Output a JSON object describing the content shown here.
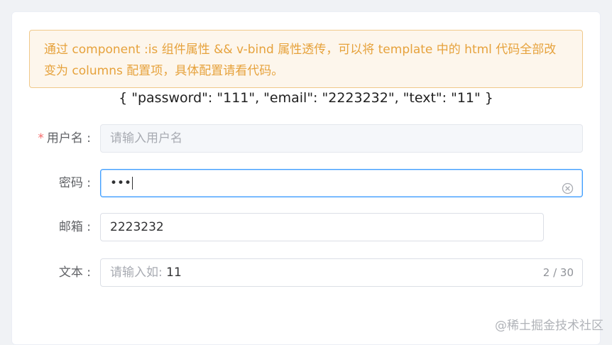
{
  "alert": {
    "text": "通过 component :is 组件属性 && v-bind 属性透传，可以将 template 中的 html 代码全部改变为 columns 配置项，具体配置请看代码。"
  },
  "model_json": "{ \"password\": \"111\", \"email\": \"2223232\", \"text\": \"11\" }",
  "form": {
    "username": {
      "required_mark": "*",
      "label": "用户名 :",
      "placeholder": "请输入用户名",
      "value": ""
    },
    "password": {
      "label": "密码 :",
      "masked_value": "•••",
      "clear_icon": "circle-close-icon"
    },
    "email": {
      "label": "邮箱 :",
      "value": "2223232"
    },
    "text": {
      "label": "文本 :",
      "prefix": "请输入如:",
      "value": "11",
      "counter": "2 / 30"
    }
  },
  "watermark": "@稀土掘金技术社区",
  "colors": {
    "alert_bg": "#fdf6ec",
    "alert_text": "#e6a23c",
    "focus_border": "#409eff",
    "required": "#f56c6c"
  }
}
